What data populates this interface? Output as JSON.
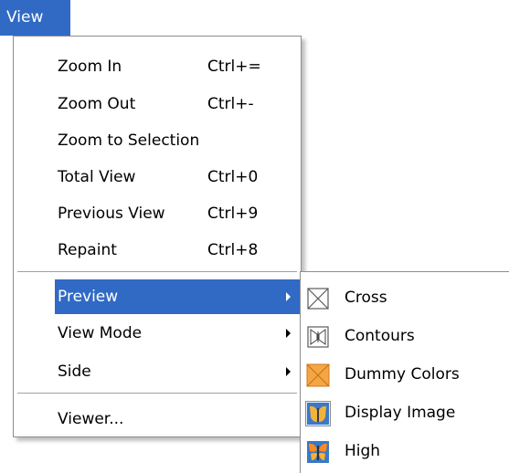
{
  "menubar": {
    "title": "View"
  },
  "menu": {
    "items": [
      {
        "label": "Zoom In",
        "shortcut": "Ctrl+="
      },
      {
        "label": "Zoom Out",
        "shortcut": "Ctrl+-"
      },
      {
        "label": "Zoom to Selection",
        "shortcut": ""
      },
      {
        "label": "Total View",
        "shortcut": "Ctrl+0"
      },
      {
        "label": "Previous View",
        "shortcut": "Ctrl+9"
      },
      {
        "label": "Repaint",
        "shortcut": "Ctrl+8"
      },
      {
        "label": "Preview",
        "submenu": true,
        "highlighted": true
      },
      {
        "label": "View Mode",
        "submenu": true
      },
      {
        "label": "Side",
        "submenu": true
      },
      {
        "label": "Viewer..."
      }
    ]
  },
  "submenu": {
    "items": [
      {
        "label": "Cross",
        "icon": "cross-icon"
      },
      {
        "label": "Contours",
        "icon": "contours-icon"
      },
      {
        "label": "Dummy Colors",
        "icon": "dummy-colors-icon"
      },
      {
        "label": "Display Image",
        "icon": "butterfly-image-icon",
        "checked": true
      },
      {
        "label": "High",
        "icon": "butterfly-high-icon"
      }
    ]
  },
  "colors": {
    "highlight": "#316ac5",
    "dummy": "#f5a542"
  }
}
